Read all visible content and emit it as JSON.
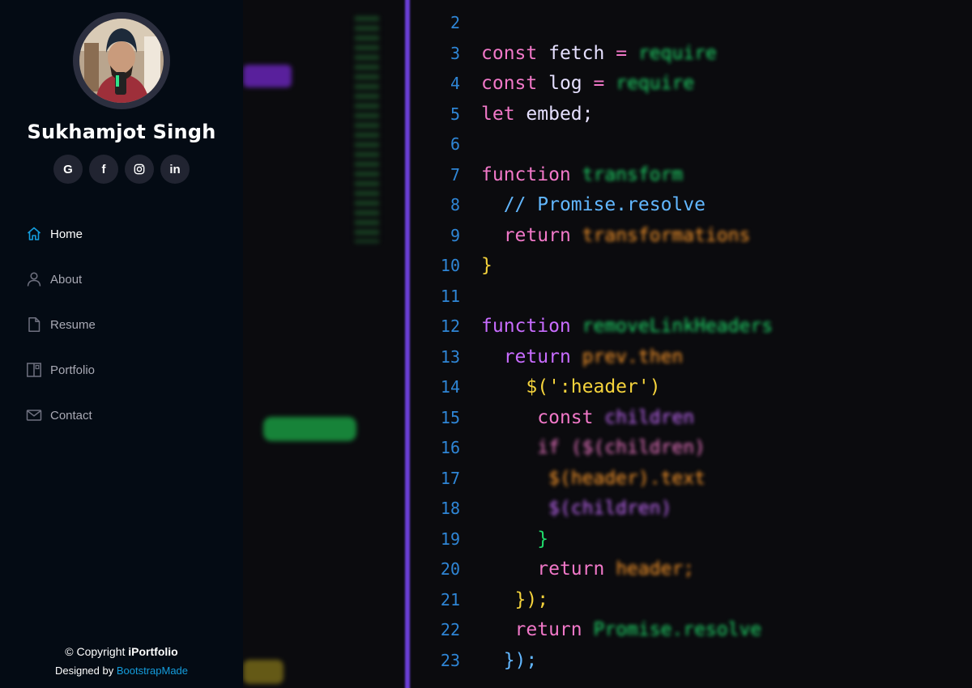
{
  "profile": {
    "name": "Sukhamjot Singh"
  },
  "social": [
    {
      "icon": "google-icon",
      "glyph": "G"
    },
    {
      "icon": "facebook-icon",
      "glyph": "f"
    },
    {
      "icon": "instagram-icon",
      "glyph": ""
    },
    {
      "icon": "linkedin-icon",
      "glyph": "in"
    }
  ],
  "nav": {
    "items": [
      {
        "label": "Home",
        "icon": "house-icon",
        "active": true
      },
      {
        "label": "About",
        "icon": "person-icon",
        "active": false
      },
      {
        "label": "Resume",
        "icon": "file-icon",
        "active": false
      },
      {
        "label": "Portfolio",
        "icon": "layout-icon",
        "active": false
      },
      {
        "label": "Contact",
        "icon": "envelope-icon",
        "active": false
      }
    ]
  },
  "footer": {
    "copyright_prefix": "© Copyright ",
    "brand": "iPortfolio",
    "designed_by": "Designed by ",
    "designer": "BootstrapMade"
  },
  "colors": {
    "sidebar_bg": "#040b14",
    "accent": "#149ddd",
    "nav_text": "#a8a9b4",
    "social_bg": "#212431"
  },
  "code_lines": {
    "n2": "2",
    "n3": "3",
    "n4": "4",
    "n5": "5",
    "n6": "6",
    "n7": "7",
    "n8": "8",
    "n9": "9",
    "n10": "10",
    "n11": "11",
    "n12": "12",
    "n13": "13",
    "n14": "14",
    "n15": "15",
    "n16": "16",
    "n17": "17",
    "n18": "18",
    "n19": "19",
    "n20": "20",
    "n21": "21",
    "n22": "22",
    "n23": "23",
    "l3a": "const",
    "l3b": "fetch",
    "l3c": "=",
    "l3d": "require",
    "l4a": "const",
    "l4b": "log",
    "l4c": "=",
    "l4d": "require",
    "l5a": "let",
    "l5b": "embed;",
    "l7a": "function",
    "l7b": "transform",
    "l8a": "// Promise.resolve",
    "l9a": "return",
    "l9b": "transformations",
    "l10a": "}",
    "l12a": "function",
    "l12b": "removeLinkHeaders",
    "l13a": "return",
    "l13b": "prev.then",
    "l14a": "$(':header')",
    "l15a": "const",
    "l15b": "children",
    "l16a": "if ($(children)",
    "l17a": "$(header).text",
    "l18a": "$(children)",
    "l19a": "}",
    "l20a": "return",
    "l20b": "header;",
    "l21a": "});",
    "l22a": "return",
    "l22b": "Promise.resolve",
    "l23a": "});"
  }
}
